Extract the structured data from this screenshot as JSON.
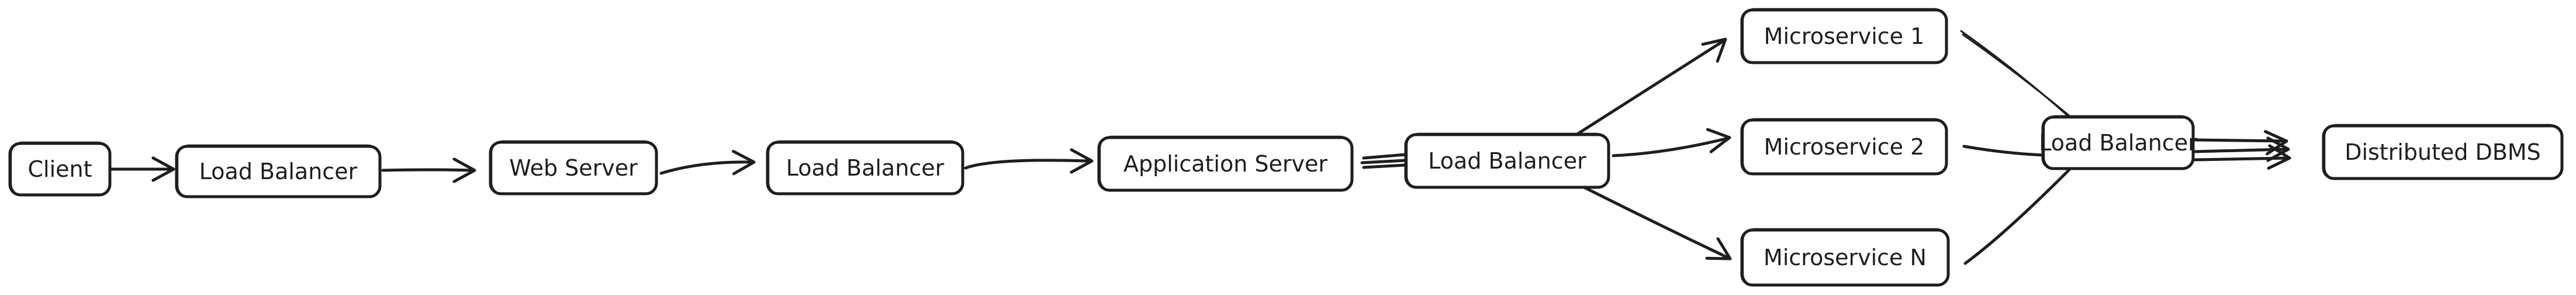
{
  "diagram": {
    "type": "architecture-flow",
    "nodes": [
      {
        "id": "client",
        "label": "Client"
      },
      {
        "id": "lb1",
        "label": "Load Balancer"
      },
      {
        "id": "web",
        "label": "Web Server"
      },
      {
        "id": "lb2",
        "label": "Load Balancer"
      },
      {
        "id": "app",
        "label": "Application Server"
      },
      {
        "id": "lb3",
        "label": "Load Balancer"
      },
      {
        "id": "ms1",
        "label": "Microservice 1"
      },
      {
        "id": "ms2",
        "label": "Microservice 2"
      },
      {
        "id": "msn",
        "label": "Microservice N"
      },
      {
        "id": "lb4",
        "label": "Load Balancer"
      },
      {
        "id": "db",
        "label": "Distributed DBMS"
      }
    ],
    "edges": [
      {
        "from": "client",
        "to": "lb1",
        "arrow": true
      },
      {
        "from": "lb1",
        "to": "web",
        "arrow": true
      },
      {
        "from": "web",
        "to": "lb2",
        "arrow": true
      },
      {
        "from": "lb2",
        "to": "app",
        "arrow": true
      },
      {
        "from": "app",
        "to": "lb3",
        "arrow": false,
        "multi": 3
      },
      {
        "from": "lb3",
        "to": "ms1",
        "arrow": true
      },
      {
        "from": "lb3",
        "to": "ms2",
        "arrow": true
      },
      {
        "from": "lb3",
        "to": "msn",
        "arrow": true
      },
      {
        "from": "ms1",
        "to": "lb4",
        "arrow": false
      },
      {
        "from": "ms2",
        "to": "lb4",
        "arrow": false
      },
      {
        "from": "msn",
        "to": "lb4",
        "arrow": false
      },
      {
        "from": "lb4",
        "to": "db",
        "arrow": true,
        "multi": 3
      }
    ],
    "stroke_color": "#1e1e1e",
    "background_color": "#ffffff"
  }
}
